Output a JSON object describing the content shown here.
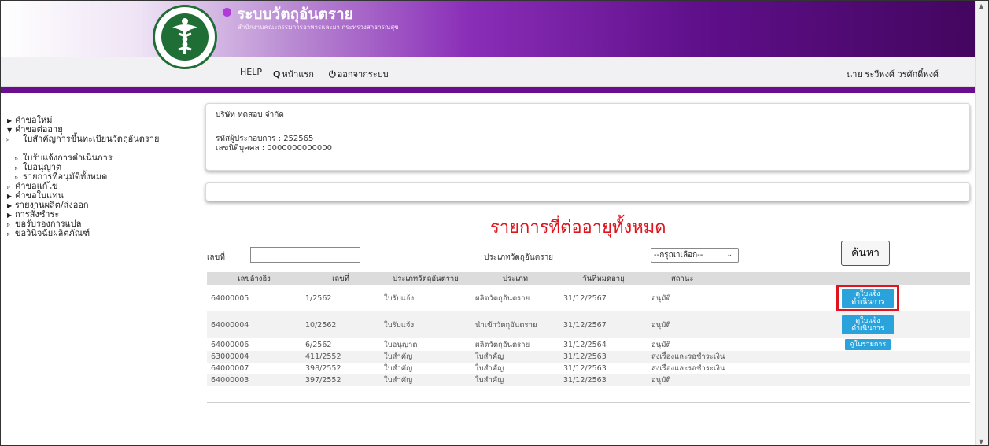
{
  "header": {
    "logo_text": "MINISTRY OF PUBLIC HEALTH",
    "title": "ระบบวัตถุอันตราย",
    "subtitle": "สำนักงานคณะกรรมการอาหารและยา กระทรวงสาธารณสุข"
  },
  "nav": {
    "help": "HELP",
    "home": "หน้าแรก",
    "logout": "ออกจากระบบ",
    "user": "นาย ระวีพงศ์ วรศักดิ์พงศ์"
  },
  "sidebar": {
    "items": [
      {
        "label": "คำขอใหม่",
        "arrow": "▶"
      },
      {
        "label": "คำขอต่ออายุ",
        "arrow": "▼"
      },
      {
        "label": "ใบสำคัญการขึ้นทะเบียนวัตถุอันตราย",
        "arrow": "▹"
      },
      {
        "label": "ใบรับแจ้งการดำเนินการ",
        "arrow": "▹"
      },
      {
        "label": "ใบอนุญาต",
        "arrow": "▹"
      },
      {
        "label": "รายการที่อนุมัติทั้งหมด",
        "arrow": "▹"
      },
      {
        "label": "คำขอแก้ไข",
        "arrow": "▹"
      },
      {
        "label": "คำขอใบแทน",
        "arrow": "▶"
      },
      {
        "label": "รายงานผลิต/ส่งออก",
        "arrow": "▶"
      },
      {
        "label": "การสั่งชำระ",
        "arrow": "▶"
      },
      {
        "label": "ขอรับรองการแปล",
        "arrow": "▹"
      },
      {
        "label": "ขอวินิจฉัยผลิตภัณฑ์",
        "arrow": "▹"
      }
    ]
  },
  "company": {
    "name": "บริษัท ทดสอบ จำกัด",
    "operator_id": "รหัสผู้ประกอบการ : 252565",
    "juristic_id": "เลขนิติบุคคล : 0000000000000"
  },
  "main": {
    "title": "รายการที่ต่ออายุทั้งหมด"
  },
  "search": {
    "number_label": "เลขที่",
    "number_value": "",
    "type_label": "ประเภทวัตถุอันตราย",
    "type_selected": "--กรุณาเลือก--",
    "button": "ค้นหา"
  },
  "table": {
    "headers": [
      "เลขอ้างอิง",
      "เลขที่",
      "ประเภทวัตถุอันตราย",
      "ประเภท",
      "วันที่หมดอายุ",
      "สถานะ",
      ""
    ],
    "rows": [
      {
        "ref": "64000005",
        "no": "1/2562",
        "hz_type": "ใบรับแจ้ง",
        "type": "ผลิตวัตถุอันตราย",
        "expiry": "31/12/2567",
        "status": "อนุมัติ",
        "action": "ดูใบแจ้งดำเนินการ"
      },
      {
        "ref": "64000004",
        "no": "10/2562",
        "hz_type": "ใบรับแจ้ง",
        "type": "นำเข้าวัตถุอันตราย",
        "expiry": "31/12/2567",
        "status": "อนุมัติ",
        "action": "ดูใบแจ้งดำเนินการ"
      },
      {
        "ref": "64000006",
        "no": "6/2562",
        "hz_type": "ใบอนุญาต",
        "type": "ผลิตวัตถุอันตราย",
        "expiry": "31/12/2564",
        "status": "อนุมัติ",
        "action": "ดูใบรายการ"
      },
      {
        "ref": "63000004",
        "no": "411/2552",
        "hz_type": "ใบสำคัญ",
        "type": "ใบสำคัญ",
        "expiry": "31/12/2563",
        "status": "ส่งเรื่องและรอชำระเงิน",
        "action": ""
      },
      {
        "ref": "64000007",
        "no": "398/2552",
        "hz_type": "ใบสำคัญ",
        "type": "ใบสำคัญ",
        "expiry": "31/12/2563",
        "status": "ส่งเรื่องและรอชำระเงิน",
        "action": ""
      },
      {
        "ref": "64000003",
        "no": "397/2552",
        "hz_type": "ใบสำคัญ",
        "type": "ใบสำคัญ",
        "expiry": "31/12/2563",
        "status": "อนุมัติ",
        "action": ""
      }
    ]
  },
  "colors": {
    "accent_purple": "#6a0d8f",
    "title_red": "#e0141e",
    "action_blue": "#2aa3dc",
    "logo_green": "#1f6e35"
  }
}
